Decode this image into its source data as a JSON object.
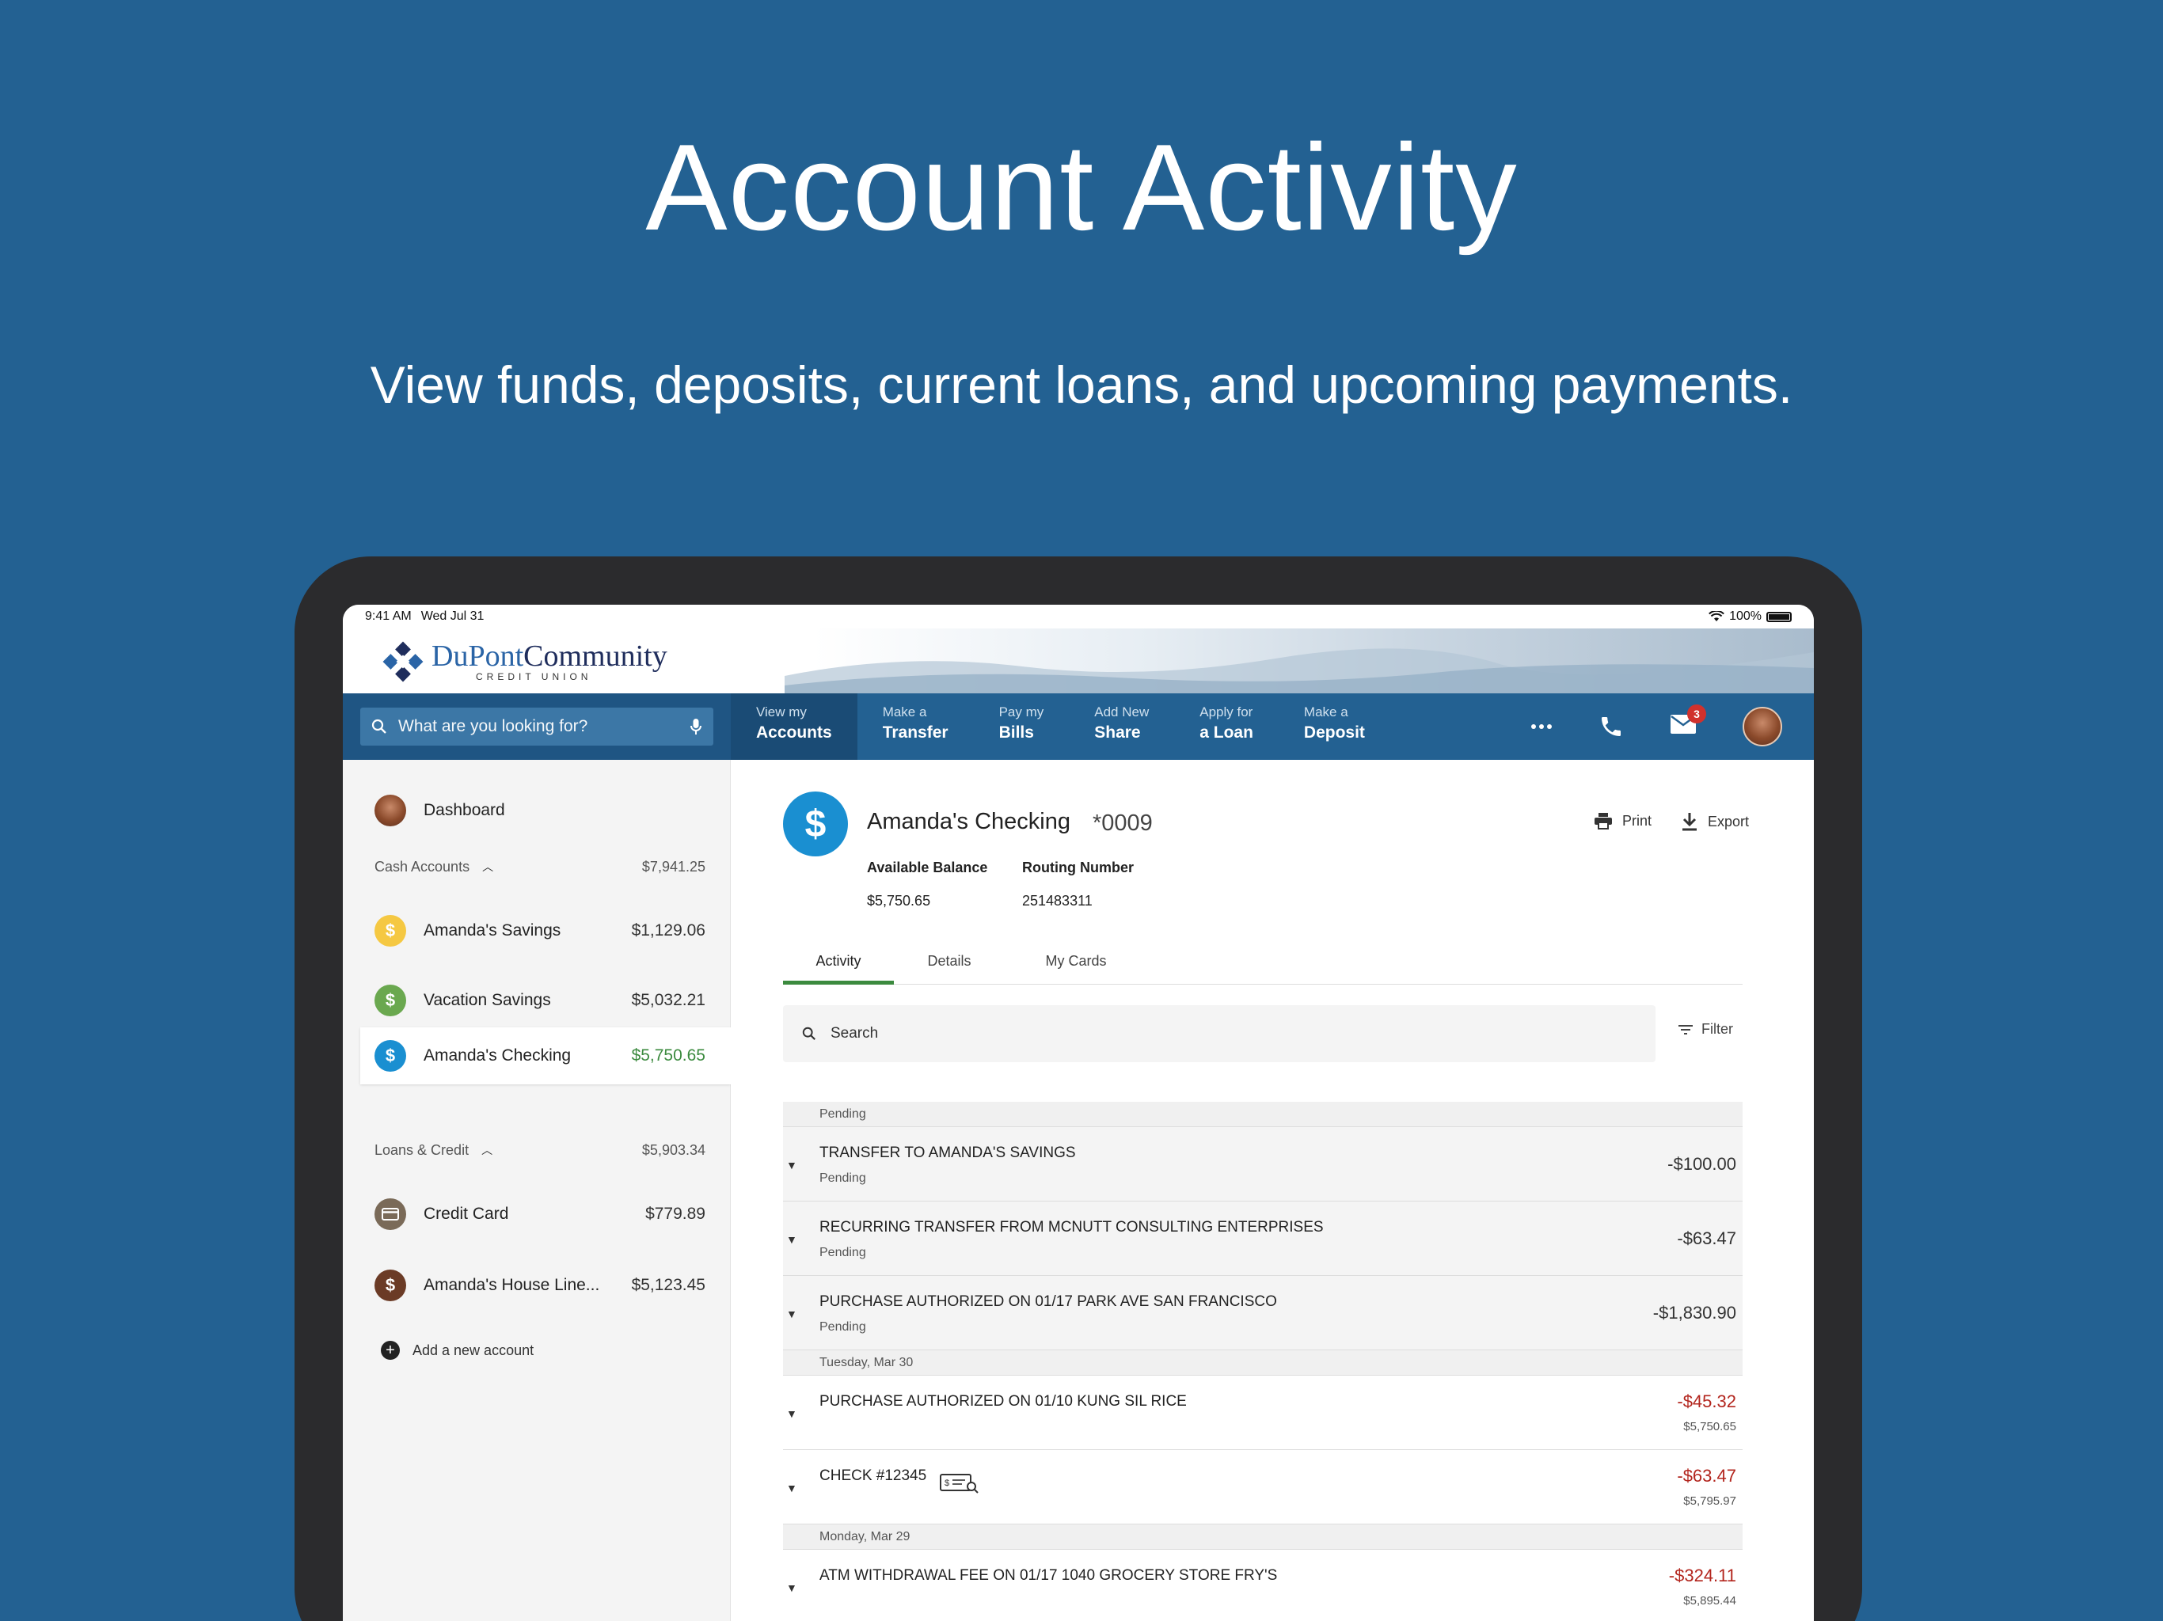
{
  "hero": {
    "title": "Account Activity",
    "subtitle": "View funds, deposits, current loans, and upcoming payments."
  },
  "status": {
    "time": "9:41 AM",
    "date": "Wed Jul 31",
    "battery": "100%"
  },
  "brand": {
    "name_a": "DuPont",
    "name_b": "Community",
    "sub": "CREDIT UNION"
  },
  "search": {
    "placeholder": "What are you looking for?"
  },
  "nav": [
    {
      "l1": "View my",
      "l2": "Accounts",
      "active": true
    },
    {
      "l1": "Make a",
      "l2": "Transfer"
    },
    {
      "l1": "Pay my",
      "l2": "Bills"
    },
    {
      "l1": "Add New",
      "l2": "Share"
    },
    {
      "l1": "Apply for",
      "l2": "a Loan"
    },
    {
      "l1": "Make a",
      "l2": "Deposit"
    }
  ],
  "nav_icons": {
    "more": "more-icon",
    "phone": "phone-icon",
    "mail": "mail-icon",
    "mail_badge": "3"
  },
  "sidebar": {
    "dashboard": "Dashboard",
    "cash_section": {
      "label": "Cash Accounts",
      "total": "$7,941.25"
    },
    "cash_accounts": [
      {
        "name": "Amanda's Savings",
        "amount": "$1,129.06",
        "color": "#f5c842"
      },
      {
        "name": "Vacation Savings",
        "amount": "$5,032.21",
        "color": "#6aa84f"
      },
      {
        "name": "Amanda's Checking",
        "amount": "$5,750.65",
        "color": "#1a8fd1"
      }
    ],
    "loans_section": {
      "label": "Loans & Credit",
      "total": "$5,903.34"
    },
    "loan_accounts": [
      {
        "name": "Credit Card",
        "amount": "$779.89",
        "color": "#7a6a58"
      },
      {
        "name": "Amanda's House Line...",
        "amount": "$5,123.45",
        "color": "#6b3b26"
      }
    ],
    "add_account": "Add a new account"
  },
  "account": {
    "name": "Amanda's Checking",
    "number": "*0009",
    "available_label": "Available Balance",
    "available": "$5,750.65",
    "routing_label": "Routing Number",
    "routing": "251483311",
    "print": "Print",
    "export": "Export"
  },
  "tabs": [
    "Activity",
    "Details",
    "My Cards"
  ],
  "activity_search": {
    "placeholder": "Search",
    "filter": "Filter"
  },
  "transactions": {
    "pending_header": "Pending",
    "pending": [
      {
        "desc": "TRANSFER TO AMANDA'S SAVINGS",
        "status": "Pending",
        "amount": "-$100.00"
      },
      {
        "desc": "RECURRING TRANSFER FROM MCNUTT CONSULTING ENTERPRISES",
        "status": "Pending",
        "amount": "-$63.47"
      },
      {
        "desc": "PURCHASE AUTHORIZED ON 01/17 PARK AVE SAN FRANCISCO",
        "status": "Pending",
        "amount": "-$1,830.90"
      }
    ],
    "group1_header": "Tuesday, Mar 30",
    "group1": [
      {
        "desc": "PURCHASE AUTHORIZED ON 01/10 KUNG SIL RICE",
        "amount": "-$45.32",
        "balance": "$5,750.65"
      },
      {
        "desc": "CHECK #12345",
        "amount": "-$63.47",
        "balance": "$5,795.97"
      }
    ],
    "group2_header": "Monday, Mar 29",
    "group2": [
      {
        "desc": "ATM WITHDRAWAL FEE ON 01/17 1040 GROCERY STORE FRY'S",
        "amount": "-$324.11",
        "balance": "$5,895.44"
      }
    ]
  }
}
